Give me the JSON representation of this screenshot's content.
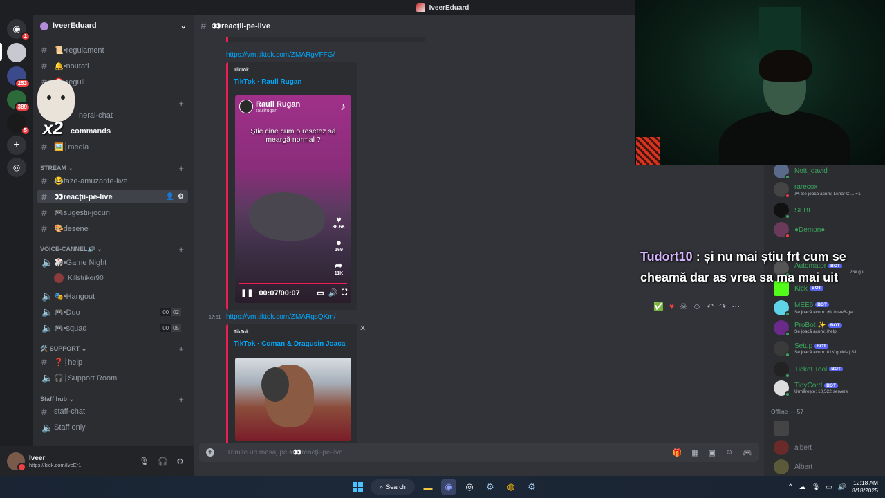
{
  "window": {
    "title": "IveerEduard"
  },
  "rail": {
    "badges": [
      "1",
      "253",
      "389",
      "5"
    ]
  },
  "guild": {
    "name": "IveerEduard"
  },
  "channels": {
    "top": [
      {
        "label": "📜•regulament"
      },
      {
        "label": "🔔•noutati"
      },
      {
        "label": "🎯•reguli"
      },
      {
        "label": "neral-chat"
      },
      {
        "label": "commands"
      },
      {
        "label": "🖼️┊media"
      }
    ],
    "stream_category": "STREAM",
    "stream": [
      {
        "label": "😂faze-amuzante-live"
      },
      {
        "label": "👀reacții-pe-live"
      },
      {
        "label": "🎮sugestii-jocuri"
      },
      {
        "label": "🎨desene"
      }
    ],
    "voice_category": "VOICE-CANNEL🔊",
    "voice": [
      {
        "label": "🎲•Game Night"
      },
      {
        "label": "🎭•Hangout"
      },
      {
        "label": "🎮•Duo",
        "c1": "00",
        "c2": "02"
      },
      {
        "label": "🎮•squad",
        "c1": "00",
        "c2": "05"
      }
    ],
    "voice_user": "Killstriker90",
    "support_category": "🛠️ SUPPORT",
    "support": [
      {
        "label": "❓┊help"
      },
      {
        "label": "🎧┊Support Room"
      }
    ],
    "staff_category": "Staff hub",
    "staff": [
      {
        "label": "staff-chat"
      },
      {
        "label": "Staff only"
      }
    ]
  },
  "sticker": {
    "text": "x2"
  },
  "user": {
    "name": "Iveer",
    "status": "https://kick.com/IveEr1"
  },
  "chat": {
    "channel": "👀reacții-pe-live",
    "link1": "https://vm.tiktok.com/ZMARgVFFG/",
    "embed1": {
      "provider": "TikTok",
      "title": "TikTok · Raull Rugan"
    },
    "video1": {
      "author": "Raull Rugan",
      "handle": "raullrugan",
      "caption": "Știe cine cum o resetez să meargă normal ?",
      "likes": "36.6K",
      "comments": "169",
      "shares": "11K",
      "time": "00:07/00:07",
      "progress": 1.0
    },
    "timestamp2": "17:51",
    "link2": "https://vm.tiktok.com/ZMARgsQKm/",
    "embed2": {
      "provider": "TikTok",
      "title": "TikTok · Coman & Dragusin Joaca"
    },
    "composer_placeholder": "Trimite un mesaj pe #👀reacții-pe-live"
  },
  "members": {
    "online": [
      {
        "name": "Nott_david",
        "sub": "",
        "bot": false,
        "color": "#3ba55d",
        "av": "#5a6a8a"
      },
      {
        "name": "rarecox",
        "sub": "🎮 Se joacă acum: Lunar Cl... +1",
        "bot": false,
        "color": "#3ba55d",
        "av": "#444"
      },
      {
        "name": "SEBI",
        "sub": "",
        "bot": false,
        "color": "#3ba55d",
        "av": "#111"
      },
      {
        "name": "●Demon●",
        "sub": "",
        "bot": false,
        "color": "#3ba55d",
        "av": "#6a3a5a"
      },
      {
        "name": "Automator",
        "sub": "26k gui",
        "bot": true,
        "color": "#3ba55d",
        "av": "#555"
      },
      {
        "name": "Kick",
        "sub": "",
        "bot": true,
        "color": "#3ba55d",
        "av": "#53fc18"
      },
      {
        "name": "MEE6",
        "sub": "Se joacă acum: 🎮 /mee6-ga...",
        "bot": true,
        "color": "#3ba55d",
        "av": "#5fd3e8"
      },
      {
        "name": "ProBot ✨",
        "sub": "Se joacă acum: /help",
        "bot": true,
        "color": "#3ba55d",
        "av": "#6a2a8a"
      },
      {
        "name": "Setup",
        "sub": "Se joacă acum: 81K guilds | S1",
        "bot": true,
        "color": "#3ba55d",
        "av": "#3a3a3a"
      },
      {
        "name": "Ticket Tool",
        "sub": "",
        "bot": true,
        "color": "#3ba55d",
        "av": "#222"
      },
      {
        "name": "TidyCord",
        "sub": "Urmărește: 10,522 servers",
        "bot": true,
        "color": "#3ba55d",
        "av": "#ddd"
      }
    ],
    "bot_label": "BOT",
    "offline_header": "Offline — 57",
    "offline": [
      {
        "name": "albert"
      },
      {
        "name": "Albert"
      }
    ]
  },
  "overlay": {
    "author": "Tudort10",
    "message": ": și nu mai știu frt cum se cheamă dar as vrea sa ma mai uit"
  },
  "taskbar": {
    "search_label": "Search",
    "time": "12:18 AM",
    "date": "8/18/2025"
  }
}
